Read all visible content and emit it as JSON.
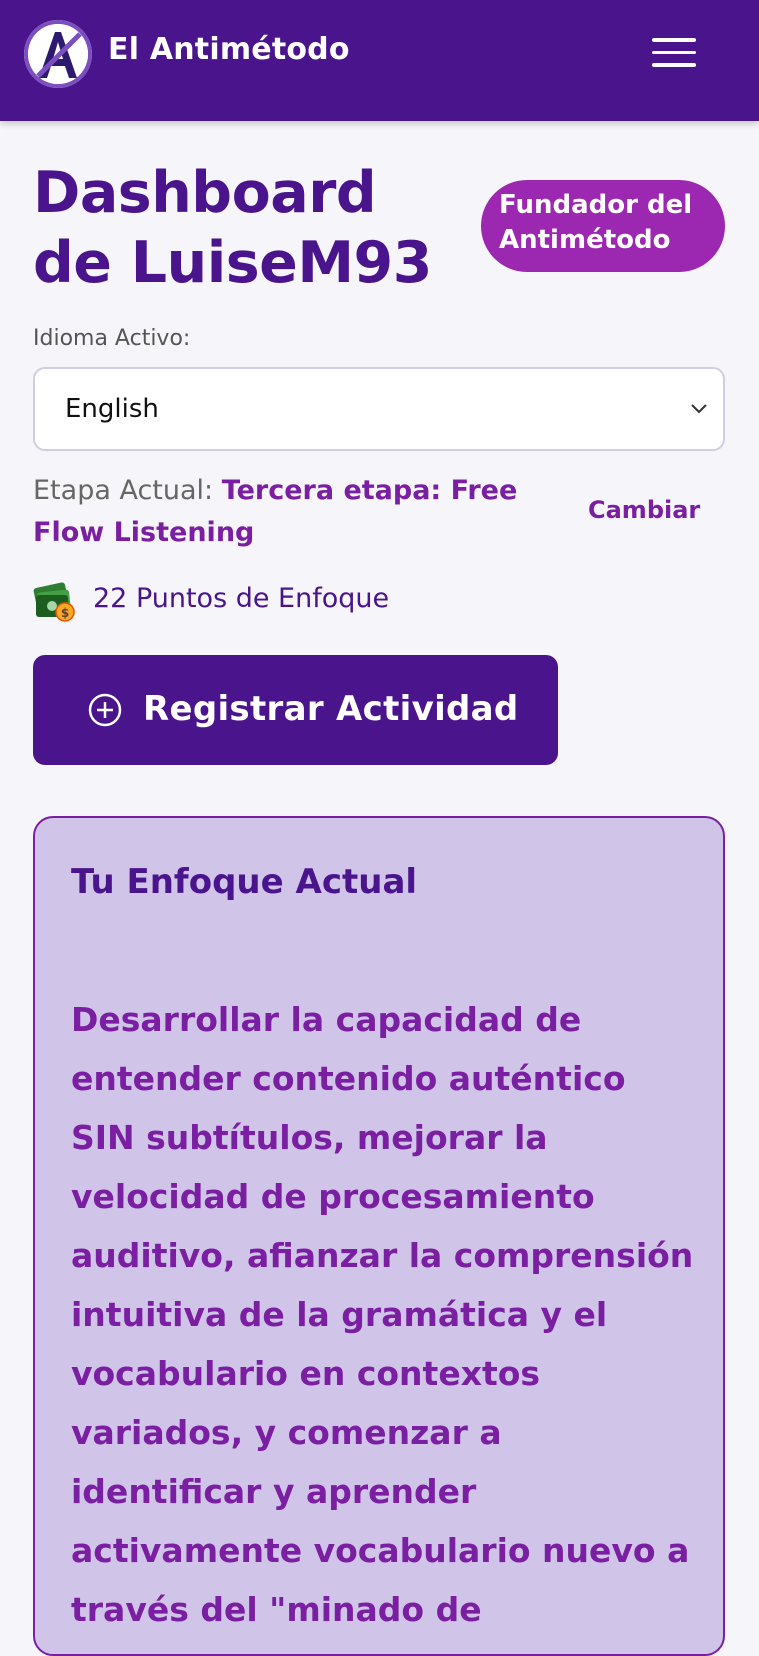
{
  "header": {
    "logo_letter": "A",
    "app_name": "El Antimétodo",
    "menu_icon": "hamburger-menu-icon"
  },
  "dashboard": {
    "title": "Dashboard de LuiseM93",
    "badge": "Fundador del Antimétodo"
  },
  "language": {
    "label": "Idioma Activo:",
    "selected": "English"
  },
  "stage": {
    "label": "Etapa Actual:",
    "value": "Tercera etapa: Free Flow Listening",
    "change_label": "Cambiar"
  },
  "points": {
    "icon": "money-coins-icon",
    "text": "22 Puntos de Enfoque"
  },
  "register": {
    "icon": "plus-circle-icon",
    "label": "Registrar Actividad"
  },
  "focus": {
    "title": "Tu Enfoque Actual",
    "text": "Desarrollar la capacidad de entender contenido auténtico SIN subtítulos, mejorar la velocidad de procesamiento auditivo, afianzar la comprensión intuitiva de la gramática y el vocabulario en contextos variados, y comenzar a identificar y aprender activamente vocabulario nuevo a través del \"minado de"
  },
  "colors": {
    "primary": "#4a148c",
    "accent": "#7b1fa2",
    "badge": "#9c27b0",
    "card": "#d1c4e9",
    "background": "#f6f5f9"
  }
}
